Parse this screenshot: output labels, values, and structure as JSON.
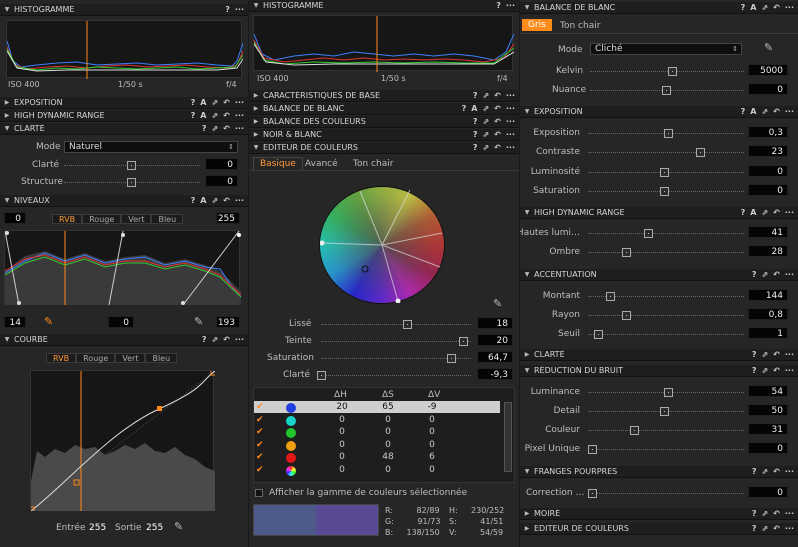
{
  "col1": {
    "histogram": {
      "title": "HISTOGRAMME",
      "iso": "ISO 400",
      "shutter": "1/50 s",
      "aperture": "f/4"
    },
    "exposition": "EXPOSITION",
    "hdr": "HIGH DYNAMIC RANGE",
    "clarte": {
      "title": "CLARTÉ",
      "mode_label": "Mode",
      "mode_value": "Naturel",
      "clarte_label": "Clarté",
      "clarte_value": "0",
      "structure_label": "Structure",
      "structure_value": "0"
    },
    "niveaux": {
      "title": "NIVEAUX",
      "low": "0",
      "high": "255",
      "tabs": [
        "RVB",
        "Rouge",
        "Vert",
        "Bleu"
      ],
      "out_low": "14",
      "mid": "0",
      "out_high": "193"
    },
    "courbe": {
      "title": "COURBE",
      "tabs": [
        "RVB",
        "Rouge",
        "Vert",
        "Bleu"
      ],
      "entree_label": "Entrée",
      "entree_value": "255",
      "sortie_label": "Sortie",
      "sortie_value": "255"
    }
  },
  "col2": {
    "histogram": {
      "title": "HISTOGRAMME",
      "iso": "ISO 400",
      "shutter": "1/50 s",
      "aperture": "f/4"
    },
    "sections": [
      "CARACTÉRISTIQUES DE BASE",
      "BALANCE DE BLANC",
      "BALANCE DES COULEURS",
      "NOIR & BLANC",
      "EDITEUR DE COULEURS"
    ],
    "editor_tabs": [
      "Basique",
      "Avancé",
      "Ton chair"
    ],
    "sliders": [
      {
        "label": "Lissé",
        "value": "18"
      },
      {
        "label": "Teinte",
        "value": "20"
      },
      {
        "label": "Saturation",
        "value": "64,7"
      },
      {
        "label": "Clarté",
        "value": "-9,3"
      }
    ],
    "table_headers": [
      "ΔH",
      "ΔS",
      "ΔV"
    ],
    "rows": [
      {
        "color": "#1f3fe0",
        "dh": "20",
        "ds": "65",
        "dv": "-9"
      },
      {
        "color": "#19d4c8",
        "dh": "0",
        "ds": "0",
        "dv": "0"
      },
      {
        "color": "#22c62a",
        "dh": "0",
        "ds": "0",
        "dv": "0"
      },
      {
        "color": "#f0a010",
        "dh": "0",
        "ds": "0",
        "dv": "0"
      },
      {
        "color": "#e01818",
        "dh": "0",
        "ds": "48",
        "dv": "6"
      },
      {
        "color": "#cc66cc",
        "dh": "0",
        "ds": "0",
        "dv": "0"
      }
    ],
    "gamut_label": "Afficher la gamme de couleurs sélectionnée",
    "readout": {
      "r": "R:",
      "r_v": "82/89",
      "g": "G:",
      "g_v": "91/73",
      "b": "B:",
      "b_v": "138/150",
      "h": "H:",
      "h_v": "230/252",
      "s": "S:",
      "s_v": "41/51",
      "v": "V:",
      "v_v": "54/59"
    },
    "swatch_a": "#4e5a8a",
    "swatch_b": "#5a4a96"
  },
  "col3": {
    "wb": {
      "title": "BALANCE DE BLANC",
      "tabs": [
        "Gris",
        "Ton chair"
      ],
      "mode_label": "Mode",
      "mode_value": "Cliché",
      "kelvin_label": "Kelvin",
      "kelvin_value": "5000",
      "nuance_label": "Nuance",
      "nuance_value": "0"
    },
    "exposition": {
      "title": "EXPOSITION",
      "items": [
        {
          "label": "Exposition",
          "value": "0,3"
        },
        {
          "label": "Contraste",
          "value": "23"
        },
        {
          "label": "Luminosité",
          "value": "0"
        },
        {
          "label": "Saturation",
          "value": "0"
        }
      ]
    },
    "hdr": {
      "title": "HIGH DYNAMIC RANGE",
      "items": [
        {
          "label": "Hautes lumi…",
          "value": "41"
        },
        {
          "label": "Ombre",
          "value": "28"
        }
      ]
    },
    "acc": {
      "title": "ACCENTUATION",
      "items": [
        {
          "label": "Montant",
          "value": "144"
        },
        {
          "label": "Rayon",
          "value": "0,8"
        },
        {
          "label": "Seuil",
          "value": "1"
        }
      ]
    },
    "clarte": "CLARTÉ",
    "bruit": {
      "title": "RÉDUCTION DU BRUIT",
      "items": [
        {
          "label": "Luminance",
          "value": "54"
        },
        {
          "label": "Detail",
          "value": "50"
        },
        {
          "label": "Couleur",
          "value": "31"
        },
        {
          "label": "Pixel Unique",
          "value": "0"
        }
      ]
    },
    "franges": {
      "title": "FRANGES POURPRES",
      "label": "Correction …",
      "value": "0"
    },
    "moire": "MOIRÉ",
    "editeur": "EDITEUR DE COULEURS"
  }
}
